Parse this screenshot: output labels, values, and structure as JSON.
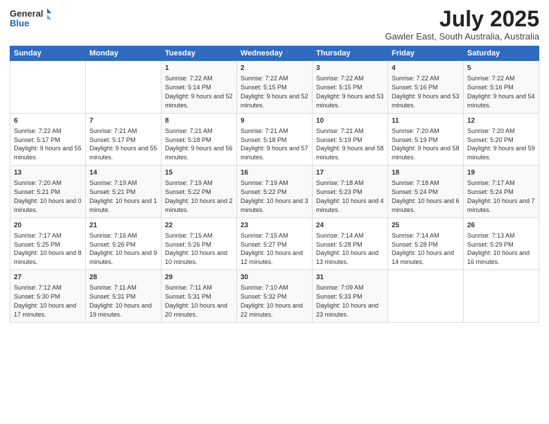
{
  "header": {
    "logo_line1": "General",
    "logo_line2": "Blue",
    "title": "July 2025",
    "subtitle": "Gawler East, South Australia, Australia"
  },
  "days_of_week": [
    "Sunday",
    "Monday",
    "Tuesday",
    "Wednesday",
    "Thursday",
    "Friday",
    "Saturday"
  ],
  "weeks": [
    [
      {
        "num": "",
        "info": ""
      },
      {
        "num": "",
        "info": ""
      },
      {
        "num": "1",
        "info": "Sunrise: 7:22 AM\nSunset: 5:14 PM\nDaylight: 9 hours and 52 minutes."
      },
      {
        "num": "2",
        "info": "Sunrise: 7:22 AM\nSunset: 5:15 PM\nDaylight: 9 hours and 52 minutes."
      },
      {
        "num": "3",
        "info": "Sunrise: 7:22 AM\nSunset: 5:15 PM\nDaylight: 9 hours and 53 minutes."
      },
      {
        "num": "4",
        "info": "Sunrise: 7:22 AM\nSunset: 5:16 PM\nDaylight: 9 hours and 53 minutes."
      },
      {
        "num": "5",
        "info": "Sunrise: 7:22 AM\nSunset: 5:16 PM\nDaylight: 9 hours and 54 minutes."
      }
    ],
    [
      {
        "num": "6",
        "info": "Sunrise: 7:22 AM\nSunset: 5:17 PM\nDaylight: 9 hours and 55 minutes."
      },
      {
        "num": "7",
        "info": "Sunrise: 7:21 AM\nSunset: 5:17 PM\nDaylight: 9 hours and 55 minutes."
      },
      {
        "num": "8",
        "info": "Sunrise: 7:21 AM\nSunset: 5:18 PM\nDaylight: 9 hours and 56 minutes."
      },
      {
        "num": "9",
        "info": "Sunrise: 7:21 AM\nSunset: 5:18 PM\nDaylight: 9 hours and 57 minutes."
      },
      {
        "num": "10",
        "info": "Sunrise: 7:21 AM\nSunset: 5:19 PM\nDaylight: 9 hours and 58 minutes."
      },
      {
        "num": "11",
        "info": "Sunrise: 7:20 AM\nSunset: 5:19 PM\nDaylight: 9 hours and 58 minutes."
      },
      {
        "num": "12",
        "info": "Sunrise: 7:20 AM\nSunset: 5:20 PM\nDaylight: 9 hours and 59 minutes."
      }
    ],
    [
      {
        "num": "13",
        "info": "Sunrise: 7:20 AM\nSunset: 5:21 PM\nDaylight: 10 hours and 0 minutes."
      },
      {
        "num": "14",
        "info": "Sunrise: 7:19 AM\nSunset: 5:21 PM\nDaylight: 10 hours and 1 minute."
      },
      {
        "num": "15",
        "info": "Sunrise: 7:19 AM\nSunset: 5:22 PM\nDaylight: 10 hours and 2 minutes."
      },
      {
        "num": "16",
        "info": "Sunrise: 7:19 AM\nSunset: 5:22 PM\nDaylight: 10 hours and 3 minutes."
      },
      {
        "num": "17",
        "info": "Sunrise: 7:18 AM\nSunset: 5:23 PM\nDaylight: 10 hours and 4 minutes."
      },
      {
        "num": "18",
        "info": "Sunrise: 7:18 AM\nSunset: 5:24 PM\nDaylight: 10 hours and 6 minutes."
      },
      {
        "num": "19",
        "info": "Sunrise: 7:17 AM\nSunset: 5:24 PM\nDaylight: 10 hours and 7 minutes."
      }
    ],
    [
      {
        "num": "20",
        "info": "Sunrise: 7:17 AM\nSunset: 5:25 PM\nDaylight: 10 hours and 8 minutes."
      },
      {
        "num": "21",
        "info": "Sunrise: 7:16 AM\nSunset: 5:26 PM\nDaylight: 10 hours and 9 minutes."
      },
      {
        "num": "22",
        "info": "Sunrise: 7:15 AM\nSunset: 5:26 PM\nDaylight: 10 hours and 10 minutes."
      },
      {
        "num": "23",
        "info": "Sunrise: 7:15 AM\nSunset: 5:27 PM\nDaylight: 10 hours and 12 minutes."
      },
      {
        "num": "24",
        "info": "Sunrise: 7:14 AM\nSunset: 5:28 PM\nDaylight: 10 hours and 13 minutes."
      },
      {
        "num": "25",
        "info": "Sunrise: 7:14 AM\nSunset: 5:28 PM\nDaylight: 10 hours and 14 minutes."
      },
      {
        "num": "26",
        "info": "Sunrise: 7:13 AM\nSunset: 5:29 PM\nDaylight: 10 hours and 16 minutes."
      }
    ],
    [
      {
        "num": "27",
        "info": "Sunrise: 7:12 AM\nSunset: 5:30 PM\nDaylight: 10 hours and 17 minutes."
      },
      {
        "num": "28",
        "info": "Sunrise: 7:11 AM\nSunset: 5:31 PM\nDaylight: 10 hours and 19 minutes."
      },
      {
        "num": "29",
        "info": "Sunrise: 7:11 AM\nSunset: 5:31 PM\nDaylight: 10 hours and 20 minutes."
      },
      {
        "num": "30",
        "info": "Sunrise: 7:10 AM\nSunset: 5:32 PM\nDaylight: 10 hours and 22 minutes."
      },
      {
        "num": "31",
        "info": "Sunrise: 7:09 AM\nSunset: 5:33 PM\nDaylight: 10 hours and 23 minutes."
      },
      {
        "num": "",
        "info": ""
      },
      {
        "num": "",
        "info": ""
      }
    ]
  ]
}
